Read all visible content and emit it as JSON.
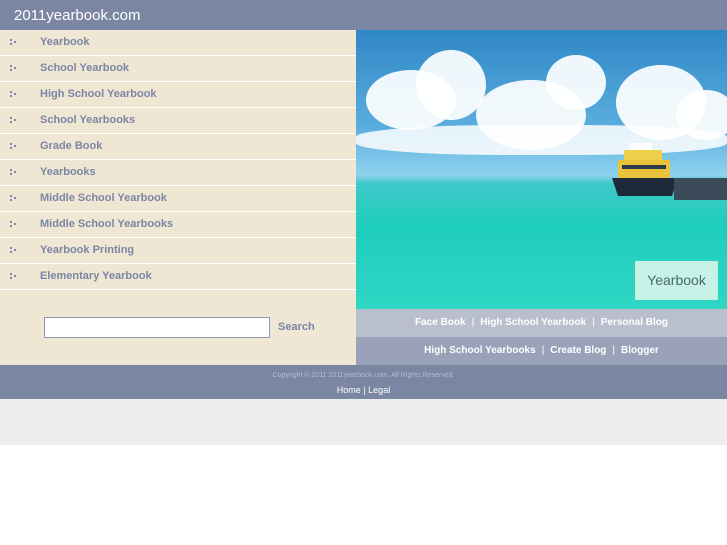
{
  "header": {
    "site_title": "2011yearbook.com"
  },
  "sidebar": {
    "items": [
      {
        "label": "Yearbook"
      },
      {
        "label": "School Yearbook"
      },
      {
        "label": "High School Yearbook"
      },
      {
        "label": "School Yearbooks"
      },
      {
        "label": "Grade Book"
      },
      {
        "label": "Yearbooks"
      },
      {
        "label": "Middle School Yearbook"
      },
      {
        "label": "Middle School Yearbooks"
      },
      {
        "label": "Yearbook Printing"
      },
      {
        "label": "Elementary Yearbook"
      }
    ],
    "search": {
      "value": "",
      "button_label": "Search"
    }
  },
  "photo": {
    "caption": "Yearbook"
  },
  "links_row1": [
    "Face Book",
    "High School Yearbook",
    "Personal Blog"
  ],
  "links_row2": [
    "High School Yearbooks",
    "Create Blog",
    "Blogger"
  ],
  "separator": "|",
  "footer": {
    "copyright": "Copyright © 2011 2011yearbook.com. All Rights Reserved.",
    "home_label": "Home",
    "legal_label": "Legal",
    "separator": "|"
  },
  "colors": {
    "header_bg": "#7b86a3",
    "sidebar_bg": "#efe6d4",
    "link_text": "#7b86a3"
  }
}
